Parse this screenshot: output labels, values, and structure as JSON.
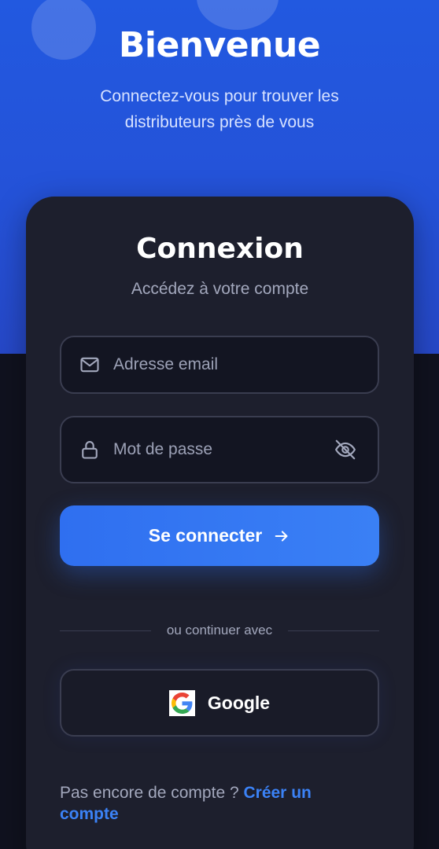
{
  "hero": {
    "title": "Bienvenue",
    "subtitle": "Connectez-vous pour trouver les distributeurs près de vous"
  },
  "login": {
    "title": "Connexion",
    "subtitle": "Accédez à votre compte",
    "email": {
      "placeholder": "Adresse email",
      "value": "",
      "icon": "mail-icon"
    },
    "password": {
      "placeholder": "Mot de passe",
      "value": "",
      "icon": "lock-icon",
      "toggle_icon": "eye-off-icon"
    },
    "submit_label": "Se connecter",
    "divider_text": "ou continuer avec",
    "google_label": "Google",
    "signup_prompt": "Pas encore de compte ?",
    "signup_link": "Créer un compte"
  },
  "colors": {
    "accent": "#3b82f6",
    "hero_bg": "#2452d8",
    "card_bg": "#1d1f2d",
    "page_bg": "#10121f"
  }
}
